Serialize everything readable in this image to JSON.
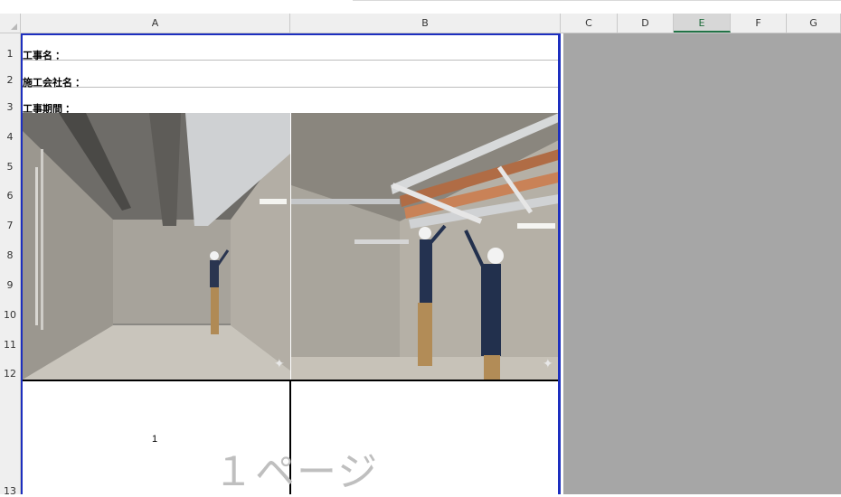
{
  "columns": [
    "A",
    "B",
    "C",
    "D",
    "E",
    "F",
    "G"
  ],
  "selected_column": "E",
  "rows": [
    "1",
    "2",
    "3",
    "4",
    "5",
    "6",
    "7",
    "8",
    "9",
    "10",
    "11",
    "12",
    "13"
  ],
  "fields": {
    "project_name": "工事名 ：",
    "contractor": "施工会社名 ：",
    "period": "工事期間 ："
  },
  "photos": {
    "left": "empty-concrete-room-photo",
    "right": "ceiling-pipe-installation-photo"
  },
  "page_number": "1",
  "page_watermark": "１ページ",
  "colors": {
    "print_area_border": "#1d2fbf",
    "outside_print_area": "#a6a6a6",
    "selected_col_accent": "#217346"
  }
}
